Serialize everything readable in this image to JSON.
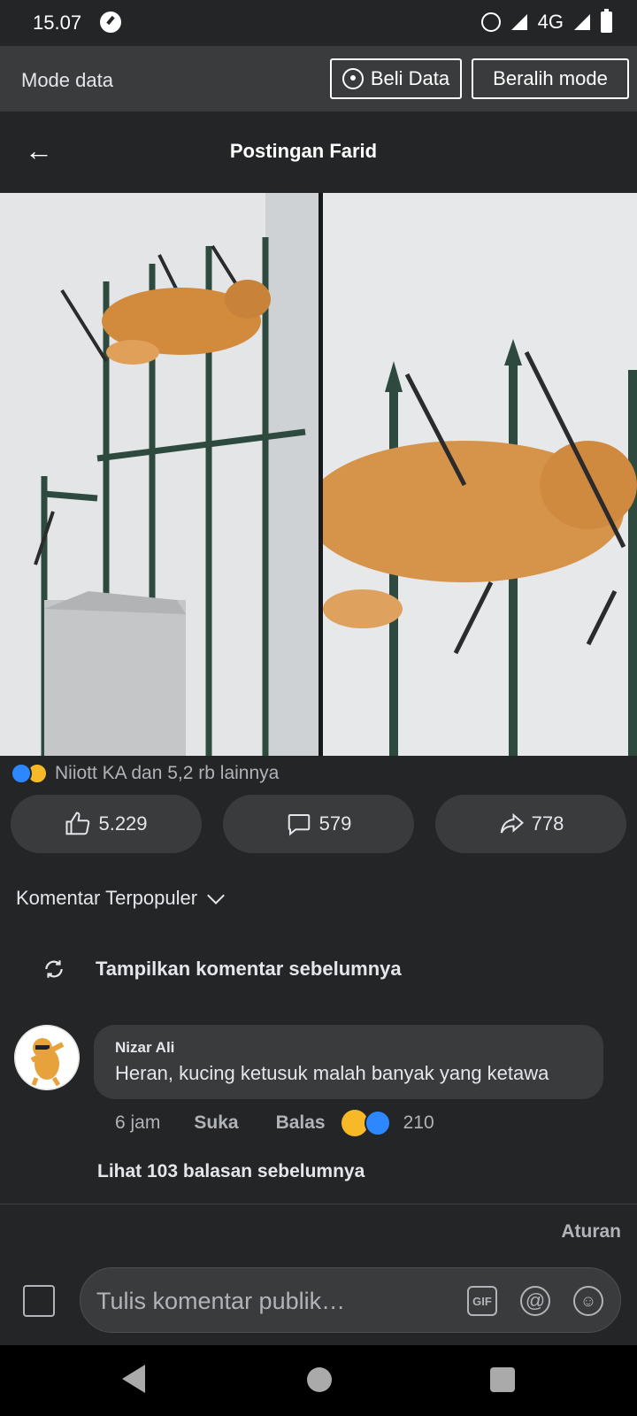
{
  "status_bar": {
    "time": "15.07",
    "network": "4G"
  },
  "data_mode": {
    "label": "Mode data",
    "buy_label": "Beli Data",
    "switch_label": "Beralih mode"
  },
  "header": {
    "title": "Postingan Farid"
  },
  "post": {
    "reactions_text": "Niiott KA dan 5,2 rb lainnya",
    "likes": "5.229",
    "comments": "579",
    "shares": "778"
  },
  "comments_section": {
    "sort_label": "Komentar Terpopuler",
    "show_previous": "Tampilkan komentar sebelumnya",
    "comment": {
      "author": "Nizar Ali",
      "text": "Heran, kucing ketusuk malah banyak yang ketawa",
      "time": "6 jam",
      "like_label": "Suka",
      "reply_label": "Balas",
      "reaction_count": "210"
    },
    "view_replies": "Lihat 103 balasan sebelumnya",
    "rules_label": "Aturan"
  },
  "composer": {
    "placeholder": "Tulis komentar publik…",
    "gif_label": "GIF",
    "at_label": "@",
    "emoji_label": "☺"
  },
  "colors": {
    "background": "#242526",
    "surface": "#3a3b3c",
    "accent_like": "#2d88ff",
    "accent_haha": "#f7b928"
  }
}
